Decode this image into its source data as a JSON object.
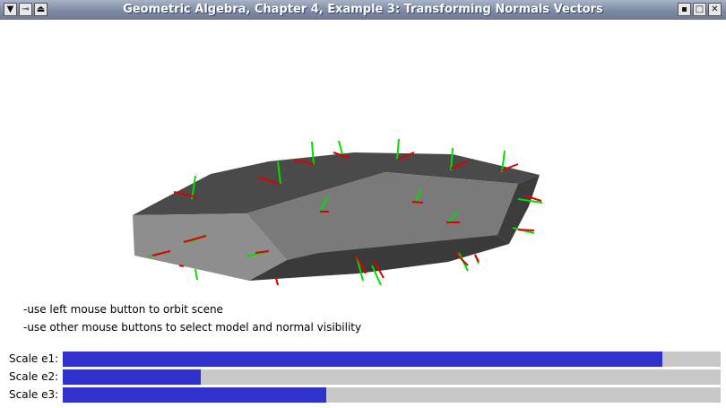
{
  "window": {
    "title": "Geometric Algebra, Chapter 4, Example 3: Transforming Normals Vectors",
    "left_buttons": [
      "menu-icon",
      "pin-icon",
      "shade-icon"
    ],
    "right_buttons": [
      "minimize-icon",
      "maximize-icon",
      "close-icon"
    ]
  },
  "scene": {
    "background": "#ffffff",
    "face_colors": {
      "top_dark": "#4a4a4a",
      "top_light": "#7a7a7a",
      "side_light": "#8e8e8e",
      "side_dark": "#3c3c3c"
    },
    "normal_color": "#00dd00",
    "tangent_color": "#dd0000"
  },
  "hints": [
    "-use left mouse button to orbit scene",
    "-use other mouse buttons to select model and normal visibility"
  ],
  "sliders": [
    {
      "label": "Scale e1:",
      "value": 0.912
    },
    {
      "label": "Scale e2:",
      "value": 0.21
    },
    {
      "label": "Scale e3:",
      "value": 0.401
    }
  ],
  "colors": {
    "slider_fill": "#3030cc",
    "slider_track": "#c8c8c8",
    "titlebar": "#7c8aa3"
  }
}
